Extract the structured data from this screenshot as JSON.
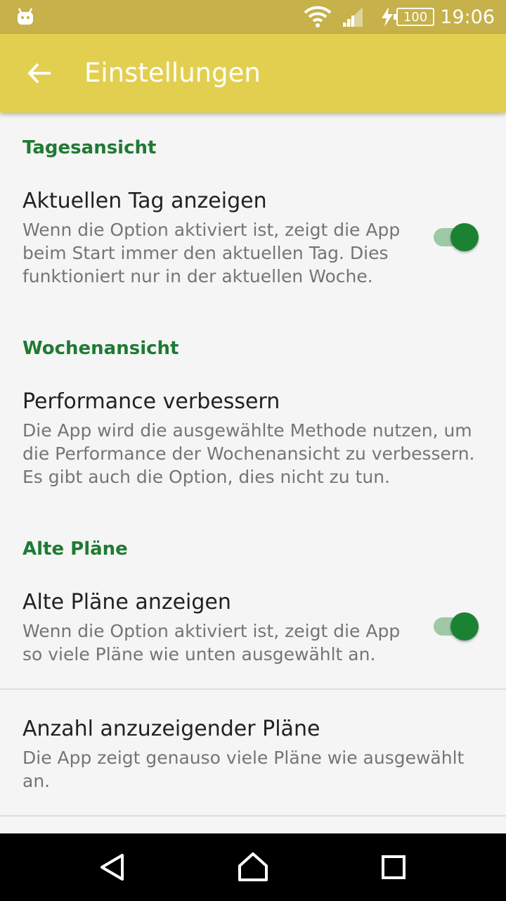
{
  "status_bar": {
    "time": "19:06",
    "battery": "100",
    "icons": [
      "android-notification-icon",
      "wifi-icon",
      "cell-signal-icon",
      "charging-icon",
      "battery-icon"
    ]
  },
  "app_bar": {
    "title": "Einstellungen",
    "back_icon": "arrow-back-icon",
    "color": "#e3cf4f"
  },
  "sections": [
    {
      "category": "Tagesansicht",
      "title": "Aktuellen Tag anzeigen",
      "summary": "Wenn die Option aktiviert ist, zeigt die App\nbeim Start immer den aktuellen Tag. Dies\nfunktioniert nur in der aktuellen Woche.",
      "switch_on": true
    },
    {
      "category": "Wochenansicht",
      "title": "Performance verbessern",
      "summary": "Die App wird die ausgewählte Methode nutzen, um\ndie Performance der Wochenansicht zu verbessern.\nEs gibt auch die Option, dies nicht zu tun."
    },
    {
      "category": "Alte Pläne",
      "title": "Alte Pläne anzeigen",
      "summary": "Wenn die Option aktiviert ist, zeigt die App\nso viele Pläne wie unten ausgewählt an.",
      "switch_on": true
    },
    {
      "title": "Anzahl anzuzeigender Pläne",
      "summary": "Die App zeigt genauso viele Pläne wie ausgewählt\nan."
    }
  ],
  "nav_bar": {
    "icons": [
      "back-triangle-icon",
      "home-icon",
      "recents-square-icon"
    ]
  },
  "colors": {
    "accent": "#1b8233",
    "category_text": "#1f7a33",
    "status_bar": "#c6b14a"
  }
}
